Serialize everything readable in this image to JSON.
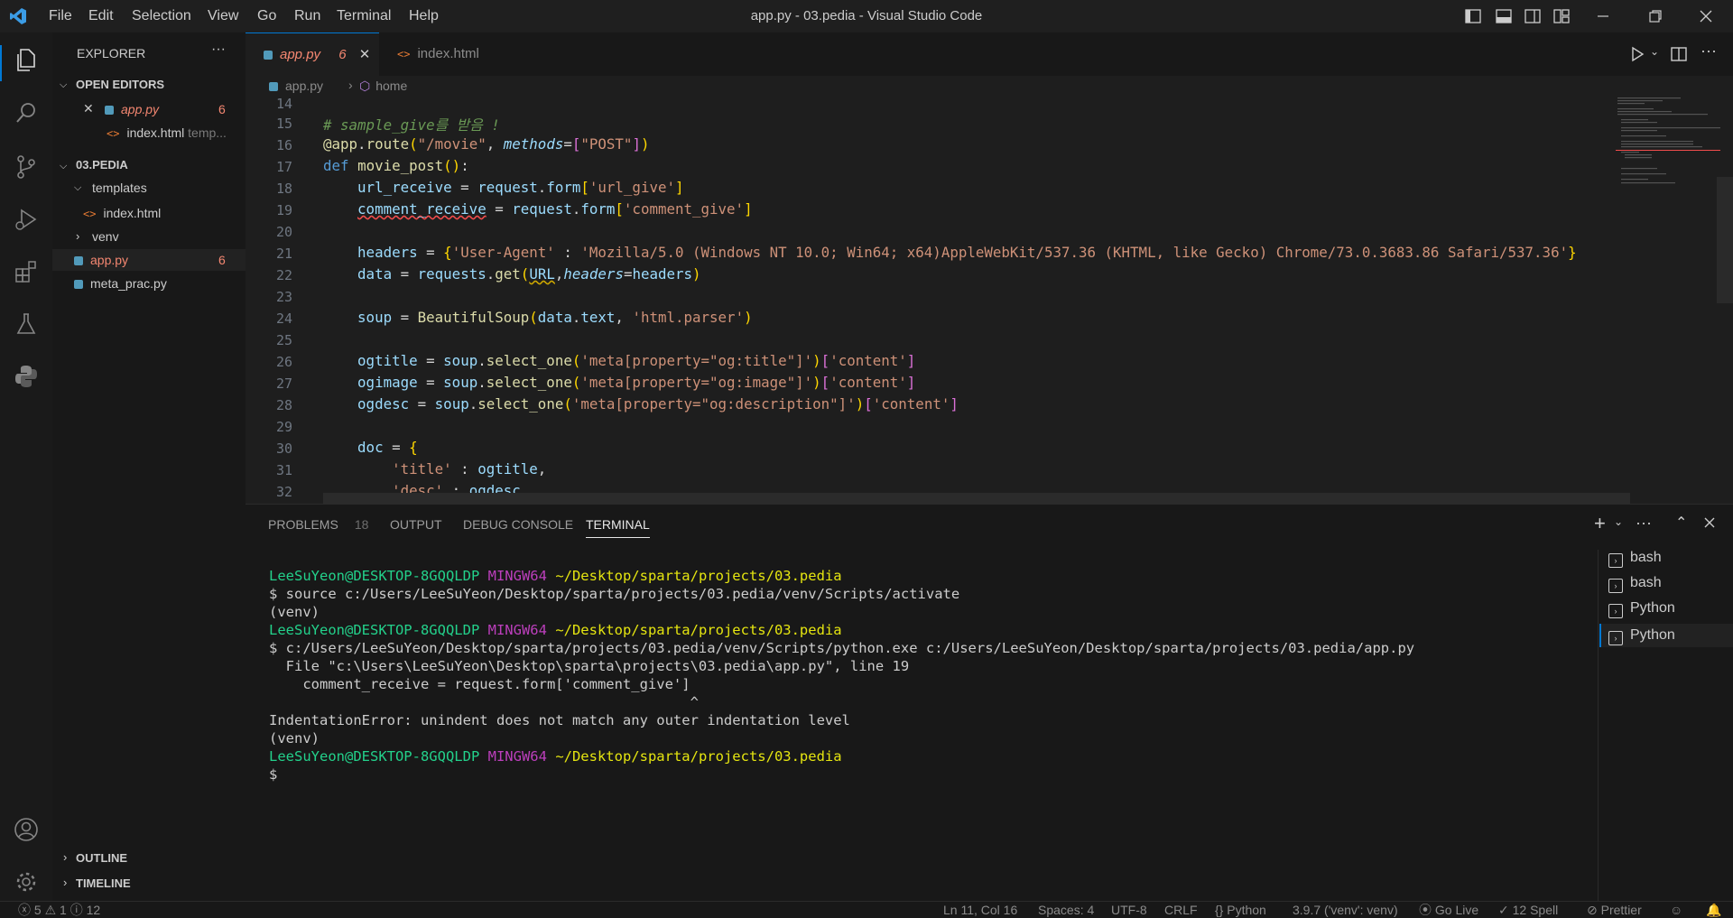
{
  "titlebar": {
    "menu": [
      "File",
      "Edit",
      "Selection",
      "View",
      "Go",
      "Run",
      "Terminal",
      "Help"
    ],
    "title": "app.py - 03.pedia - Visual Studio Code"
  },
  "sidebar": {
    "header": "EXPLORER",
    "more": "···",
    "open_editors": "OPEN EDITORS",
    "open_files": [
      {
        "name": "app.py",
        "badge": "6"
      },
      {
        "name": "index.html",
        "hint": "temp..."
      }
    ],
    "project": "03.PEDIA",
    "tree": [
      {
        "name": "templates"
      },
      {
        "name": "index.html"
      },
      {
        "name": "venv"
      },
      {
        "name": "app.py",
        "badge": "6"
      },
      {
        "name": "meta_prac.py"
      }
    ],
    "outline": "OUTLINE",
    "timeline": "TIMELINE"
  },
  "tabs": [
    {
      "name": "app.py",
      "badge": "6",
      "close": "✕"
    },
    {
      "name": "index.html"
    }
  ],
  "breadcrumb": {
    "file": "app.py",
    "symbol": "home"
  },
  "editor": {
    "line_numbers": [
      "14",
      "15",
      "16",
      "17",
      "18",
      "19",
      "20",
      "21",
      "22",
      "23",
      "24",
      "25",
      "26",
      "27",
      "28",
      "29",
      "30",
      "31",
      "32"
    ],
    "comment_line": "# sample_give를 받음 !"
  },
  "panel": {
    "tabs": [
      "PROBLEMS",
      "OUTPUT",
      "DEBUG CONSOLE",
      "TERMINAL"
    ],
    "problems_count": "18",
    "terminal_lines": [
      {
        "user": "LeeSuYeon@DESKTOP-8GQQLDP",
        "shell": "MINGW64",
        "path": "~/Desktop/sparta/projects/03.pedia"
      },
      {
        "text": "$ source c:/Users/LeeSuYeon/Desktop/sparta/projects/03.pedia/venv/Scripts/activate"
      },
      {
        "text": "(venv)"
      },
      {
        "user": "LeeSuYeon@DESKTOP-8GQQLDP",
        "shell": "MINGW64",
        "path": "~/Desktop/sparta/projects/03.pedia"
      },
      {
        "text": "$ c:/Users/LeeSuYeon/Desktop/sparta/projects/03.pedia/venv/Scripts/python.exe c:/Users/LeeSuYeon/Desktop/sparta/projects/03.pedia/app.py"
      },
      {
        "text": "  File \"c:\\Users\\LeeSuYeon\\Desktop\\sparta\\projects\\03.pedia\\app.py\", line 19"
      },
      {
        "text": "    comment_receive = request.form['comment_give']"
      },
      {
        "text": "                                                  ^"
      },
      {
        "text": "IndentationError: unindent does not match any outer indentation level"
      },
      {
        "text": "(venv)"
      },
      {
        "user": "LeeSuYeon@DESKTOP-8GQQLDP",
        "shell": "MINGW64",
        "path": "~/Desktop/sparta/projects/03.pedia"
      },
      {
        "text": "$"
      }
    ],
    "terminals": [
      "bash",
      "bash",
      "Python",
      "Python"
    ]
  },
  "statusbar": {
    "errors": "5",
    "warnings": "1",
    "infos": "12",
    "position": "Ln 11, Col 16",
    "spaces": "Spaces: 4",
    "encoding": "UTF-8",
    "eol": "CRLF",
    "language": "Python",
    "interpreter": "3.9.7 ('venv': venv)",
    "golive": "Go Live",
    "spell": "12 Spell",
    "prettier": "Prettier"
  }
}
